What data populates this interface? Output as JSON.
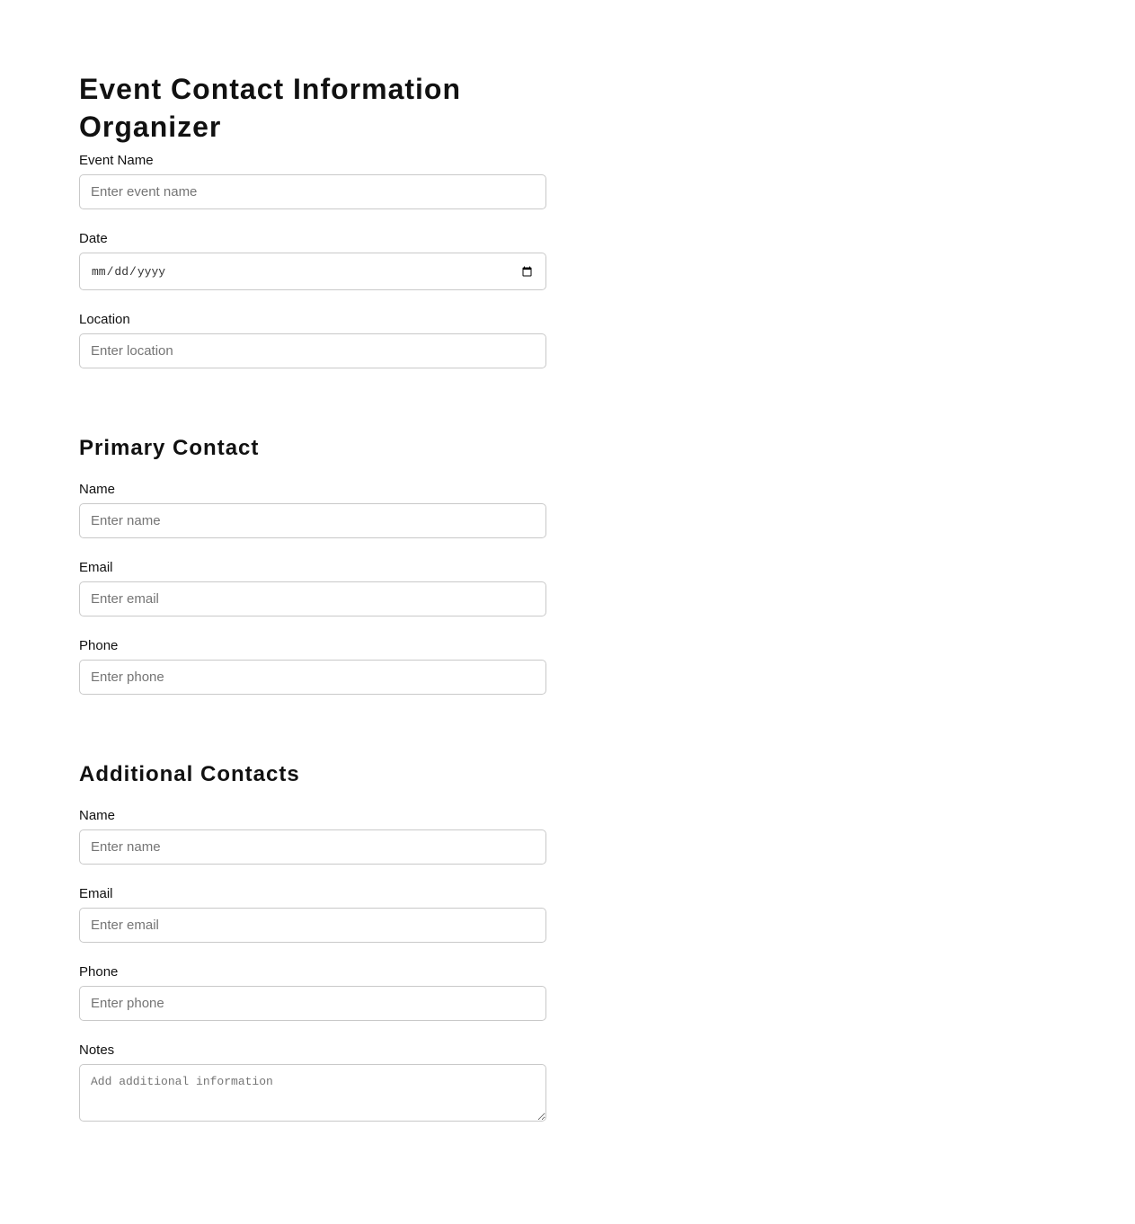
{
  "title": "Event Contact Information Organizer",
  "event": {
    "name_label": "Event Name",
    "name_placeholder": "Enter event name",
    "date_label": "Date",
    "date_placeholder": "mm/dd/yyyy",
    "location_label": "Location",
    "location_placeholder": "Enter location"
  },
  "primary": {
    "heading": "Primary Contact",
    "name_label": "Name",
    "name_placeholder": "Enter name",
    "email_label": "Email",
    "email_placeholder": "Enter email",
    "phone_label": "Phone",
    "phone_placeholder": "Enter phone"
  },
  "additional": {
    "heading": "Additional Contacts",
    "name_label": "Name",
    "name_placeholder": "Enter name",
    "email_label": "Email",
    "email_placeholder": "Enter email",
    "phone_label": "Phone",
    "phone_placeholder": "Enter phone",
    "notes_label": "Notes",
    "notes_placeholder": "Add additional information"
  },
  "icons": {
    "date_picker": "calendar-icon"
  }
}
